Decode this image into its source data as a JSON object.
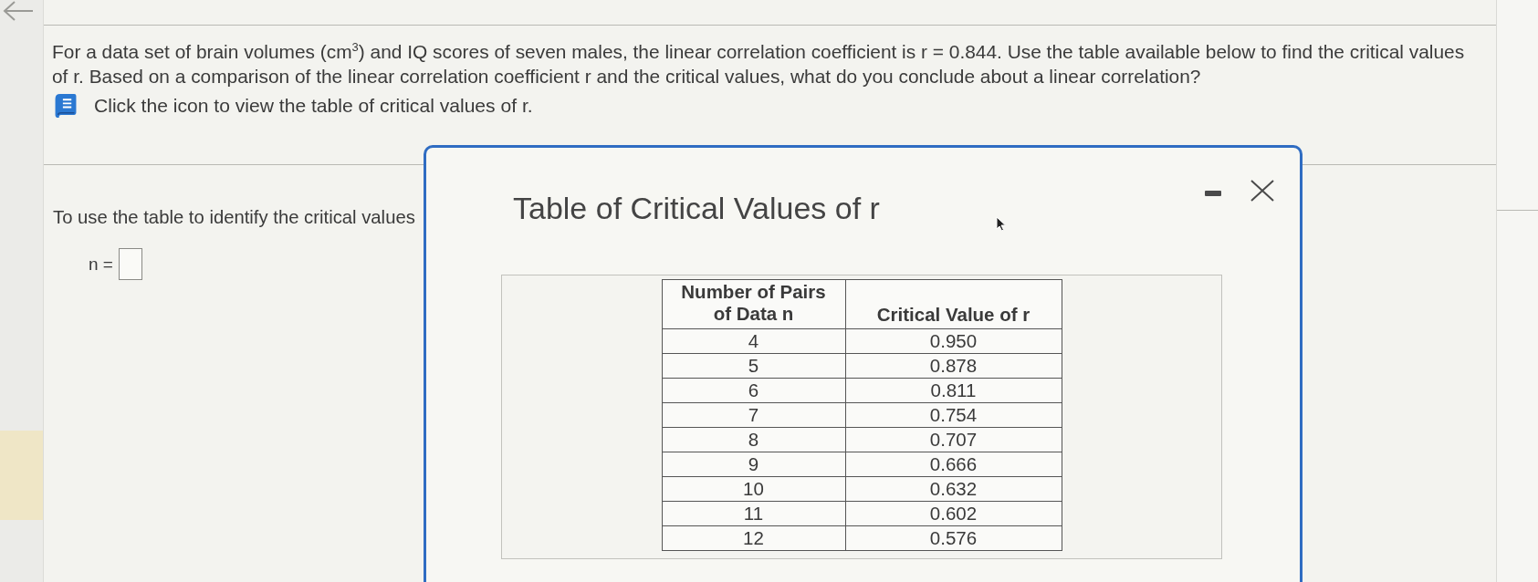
{
  "question": {
    "text": "For a data set of brain volumes (cm$^{3}$) and IQ scores of seven males, the linear correlation coefficient is r = 0.844. Use the table available below to find the critical values of r. Based on a comparison of the linear correlation coefficient r and the critical values, what do you conclude about a linear correlation?"
  },
  "hint": {
    "text": "Click the icon to view the table of critical values of r."
  },
  "prompt": {
    "text": "To use the table to identify the critical values",
    "answer_label": "n ="
  },
  "dialog": {
    "title": "Table of Critical Values of r",
    "table": {
      "columns": [
        "Number of Pairs\nof Data n",
        "Critical Value of r"
      ],
      "rows": [
        [
          "4",
          "0.950"
        ],
        [
          "5",
          "0.878"
        ],
        [
          "6",
          "0.811"
        ],
        [
          "7",
          "0.754"
        ],
        [
          "8",
          "0.707"
        ],
        [
          "9",
          "0.666"
        ],
        [
          "10",
          "0.632"
        ],
        [
          "11",
          "0.602"
        ],
        [
          "12",
          "0.576"
        ]
      ]
    }
  }
}
